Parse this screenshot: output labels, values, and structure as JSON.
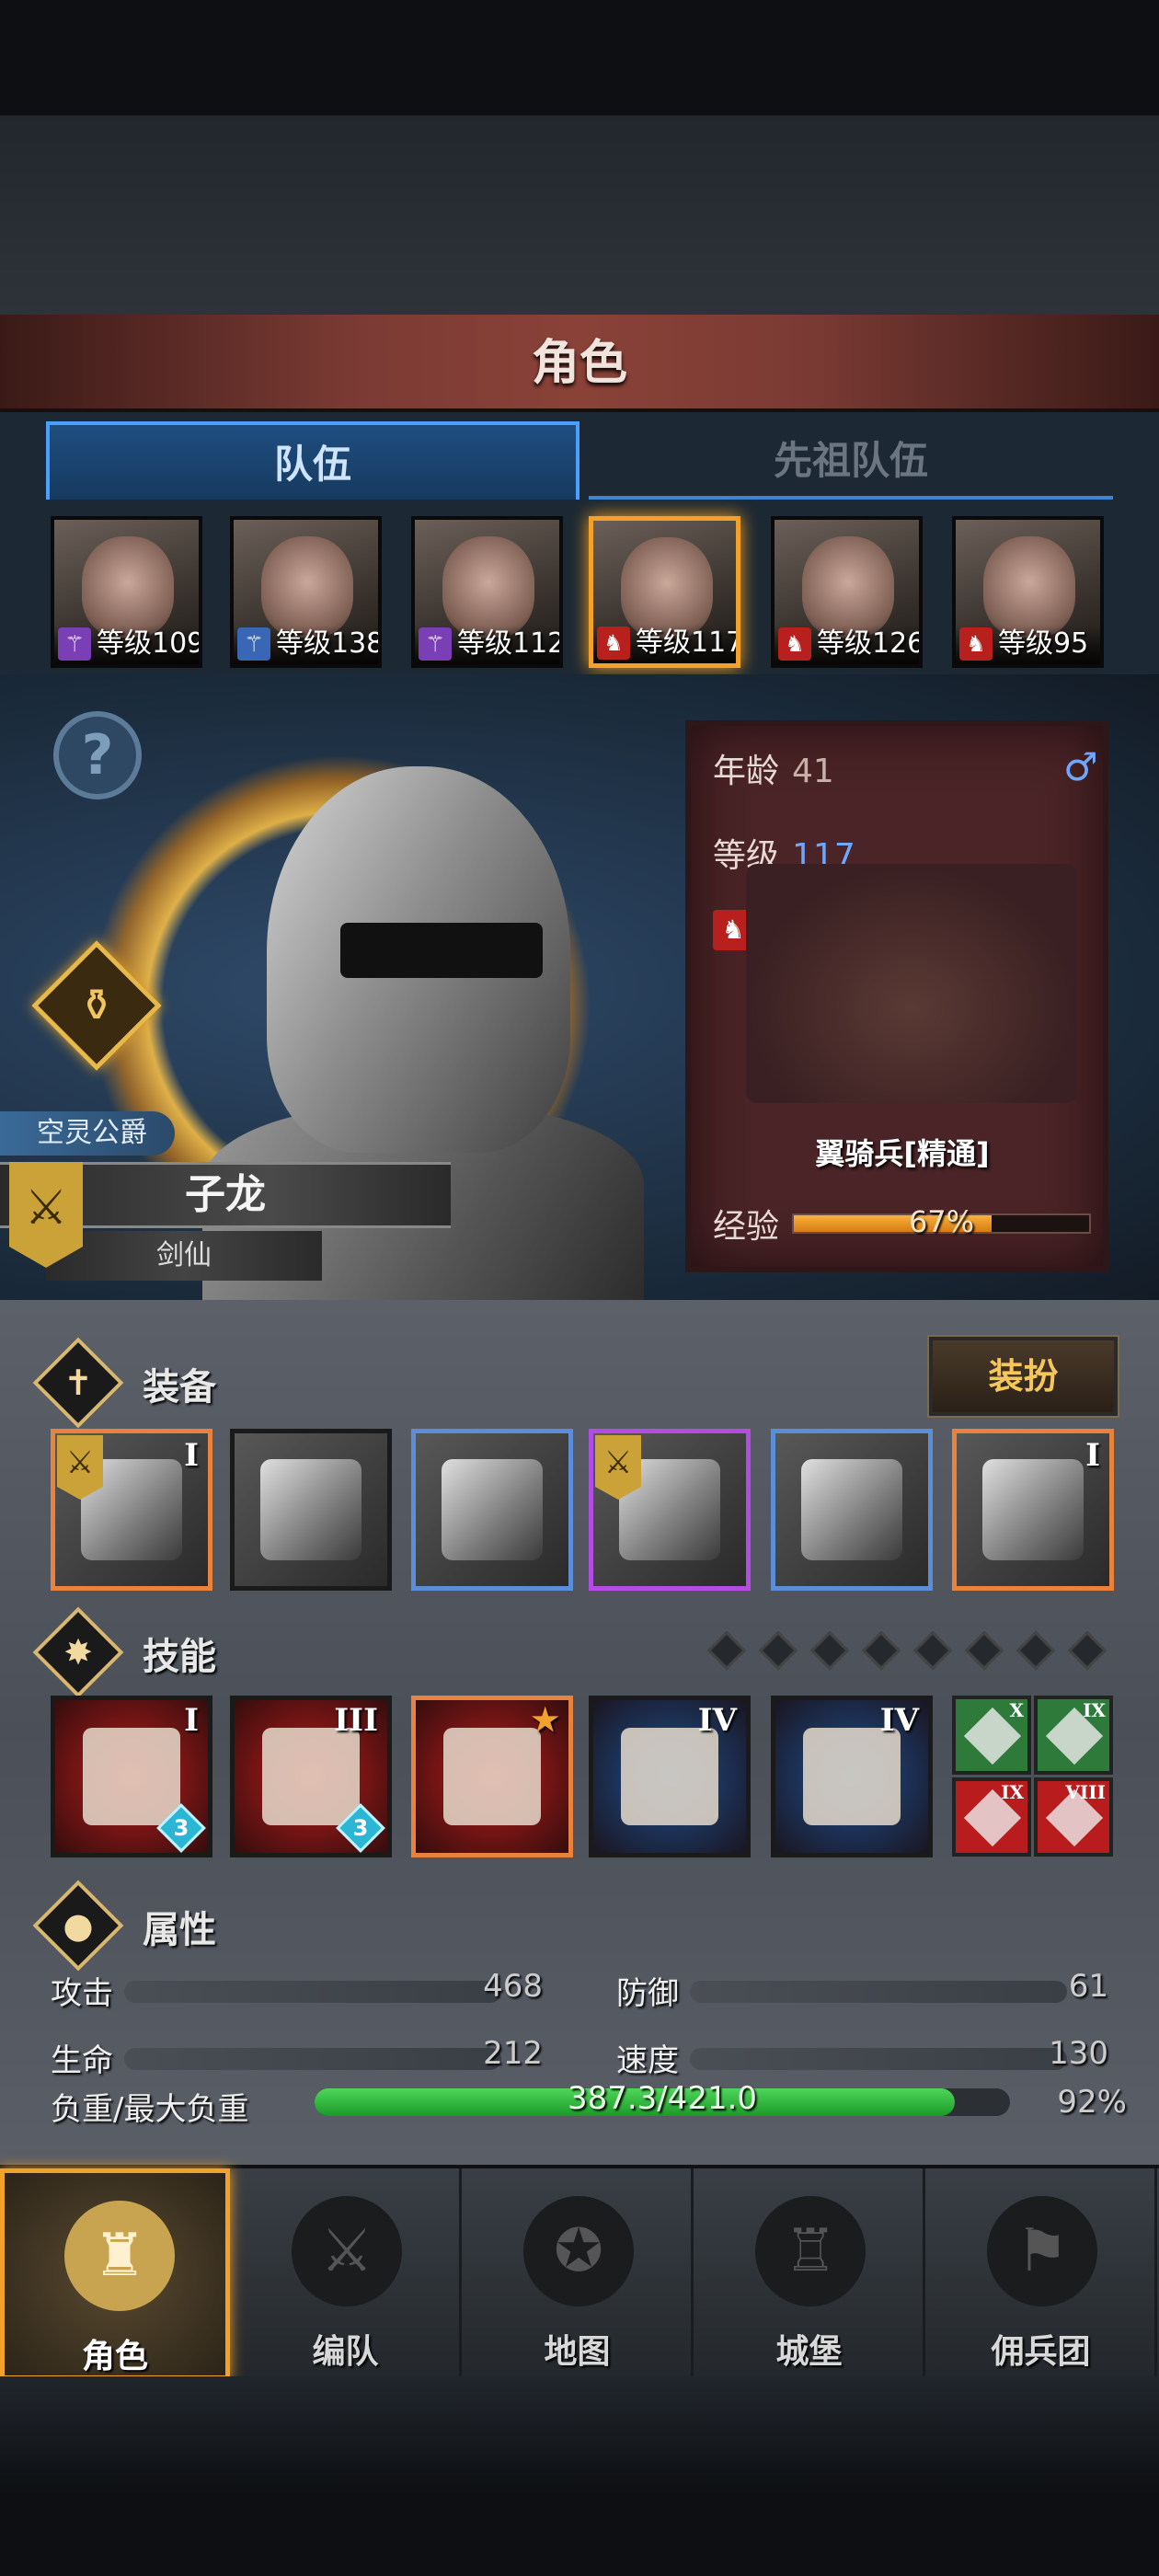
{
  "header": {
    "title": "角色"
  },
  "tabs": [
    {
      "label": "队伍",
      "active": true
    },
    {
      "label": "先祖队伍",
      "active": false
    }
  ],
  "party": [
    {
      "level_text": "等级109",
      "class_icon": "staff-icon",
      "icon_color": "#7b3fb5"
    },
    {
      "level_text": "等级138",
      "class_icon": "staff-icon",
      "icon_color": "#3a67b5"
    },
    {
      "level_text": "等级112",
      "class_icon": "staff-icon",
      "icon_color": "#7b3fb5"
    },
    {
      "level_text": "等级117",
      "class_icon": "horse-icon",
      "icon_color": "#b7201c",
      "selected": true
    },
    {
      "level_text": "等级126",
      "class_icon": "horse-icon",
      "icon_color": "#b7201c"
    },
    {
      "level_text": "等级95",
      "class_icon": "horse-icon",
      "icon_color": "#b7201c"
    }
  ],
  "hero": {
    "title": "空灵公爵",
    "name": "子龙",
    "class": "剑仙",
    "age_label": "年龄",
    "age": "41",
    "level_label": "等级",
    "level": "117",
    "unit_name": "翼骑兵[精通]",
    "exp_label": "经验",
    "exp_text": "67%",
    "exp_fraction": 0.67,
    "sex_icon": "♂"
  },
  "equipment": {
    "section": "装备",
    "dress_button": "装扮",
    "slots": [
      {
        "icon": "weapon-icon",
        "tier": "I",
        "flag": true,
        "border": "#e8823c"
      },
      {
        "icon": "offhand-icon",
        "tier": "",
        "flag": false,
        "border": "#1a1a1a"
      },
      {
        "icon": "helmet-icon",
        "tier": "",
        "flag": false,
        "border": "#5b8ed6"
      },
      {
        "icon": "chest-armor-icon",
        "tier": "",
        "flag": true,
        "border": "#b34ce0"
      },
      {
        "icon": "boots-icon",
        "tier": "",
        "flag": false,
        "border": "#5b8ed6"
      },
      {
        "icon": "book-icon",
        "tier": "I",
        "flag": false,
        "border": "#e8823c"
      }
    ]
  },
  "skills": {
    "section": "技能",
    "items": [
      {
        "icon": "sword-slash-icon",
        "tier": "I",
        "badge": "3",
        "bg": "#b81c1c",
        "border": "#1a1a1a"
      },
      {
        "icon": "summon-icon",
        "tier": "III",
        "badge": "3",
        "bg": "#b81c1c",
        "border": "#1a1a1a"
      },
      {
        "icon": "banner-charge-icon",
        "tier": "★",
        "badge": "",
        "bg": "#b81c1c",
        "border": "#e8823c"
      },
      {
        "icon": "crystal-sword-icon",
        "tier": "IV",
        "badge": "",
        "bg": "#1d4e8f",
        "border": "#1a1a1a"
      },
      {
        "icon": "crystal-horse-icon",
        "tier": "IV",
        "badge": "",
        "bg": "#1d4e8f",
        "border": "#1a1a1a"
      }
    ],
    "mini": [
      {
        "icon": "burst-icon",
        "tier": "X",
        "bg": "#2e7a3a"
      },
      {
        "icon": "target-icon",
        "tier": "IX",
        "bg": "#2e7a3a"
      },
      {
        "icon": "sword-icon",
        "tier": "IX",
        "bg": "#b81c1c"
      },
      {
        "icon": "sword-icon",
        "tier": "VIII",
        "bg": "#b81c1c"
      }
    ]
  },
  "attributes": {
    "section": "属性",
    "attack_label": "攻击",
    "attack": "468",
    "defense_label": "防御",
    "defense": "61",
    "hp_label": "生命",
    "hp": "212",
    "speed_label": "速度",
    "speed": "130",
    "load_label": "负重/最大负重",
    "load_text": "387.3/421.0",
    "load_percent": "92%",
    "load_fraction": 0.92
  },
  "nav": [
    {
      "label": "角色",
      "icon": "knight-icon",
      "active": true
    },
    {
      "label": "编队",
      "icon": "formation-icon",
      "active": false
    },
    {
      "label": "地图",
      "icon": "compass-map-icon",
      "active": false
    },
    {
      "label": "城堡",
      "icon": "castle-icon",
      "active": false
    },
    {
      "label": "佣兵团",
      "icon": "mercenary-icon",
      "active": false
    }
  ],
  "colors": {
    "accent": "#f2a12a",
    "tab_blue": "#4aa0ff",
    "header_red": "#8a4238",
    "load_green": "#2ec23a"
  }
}
